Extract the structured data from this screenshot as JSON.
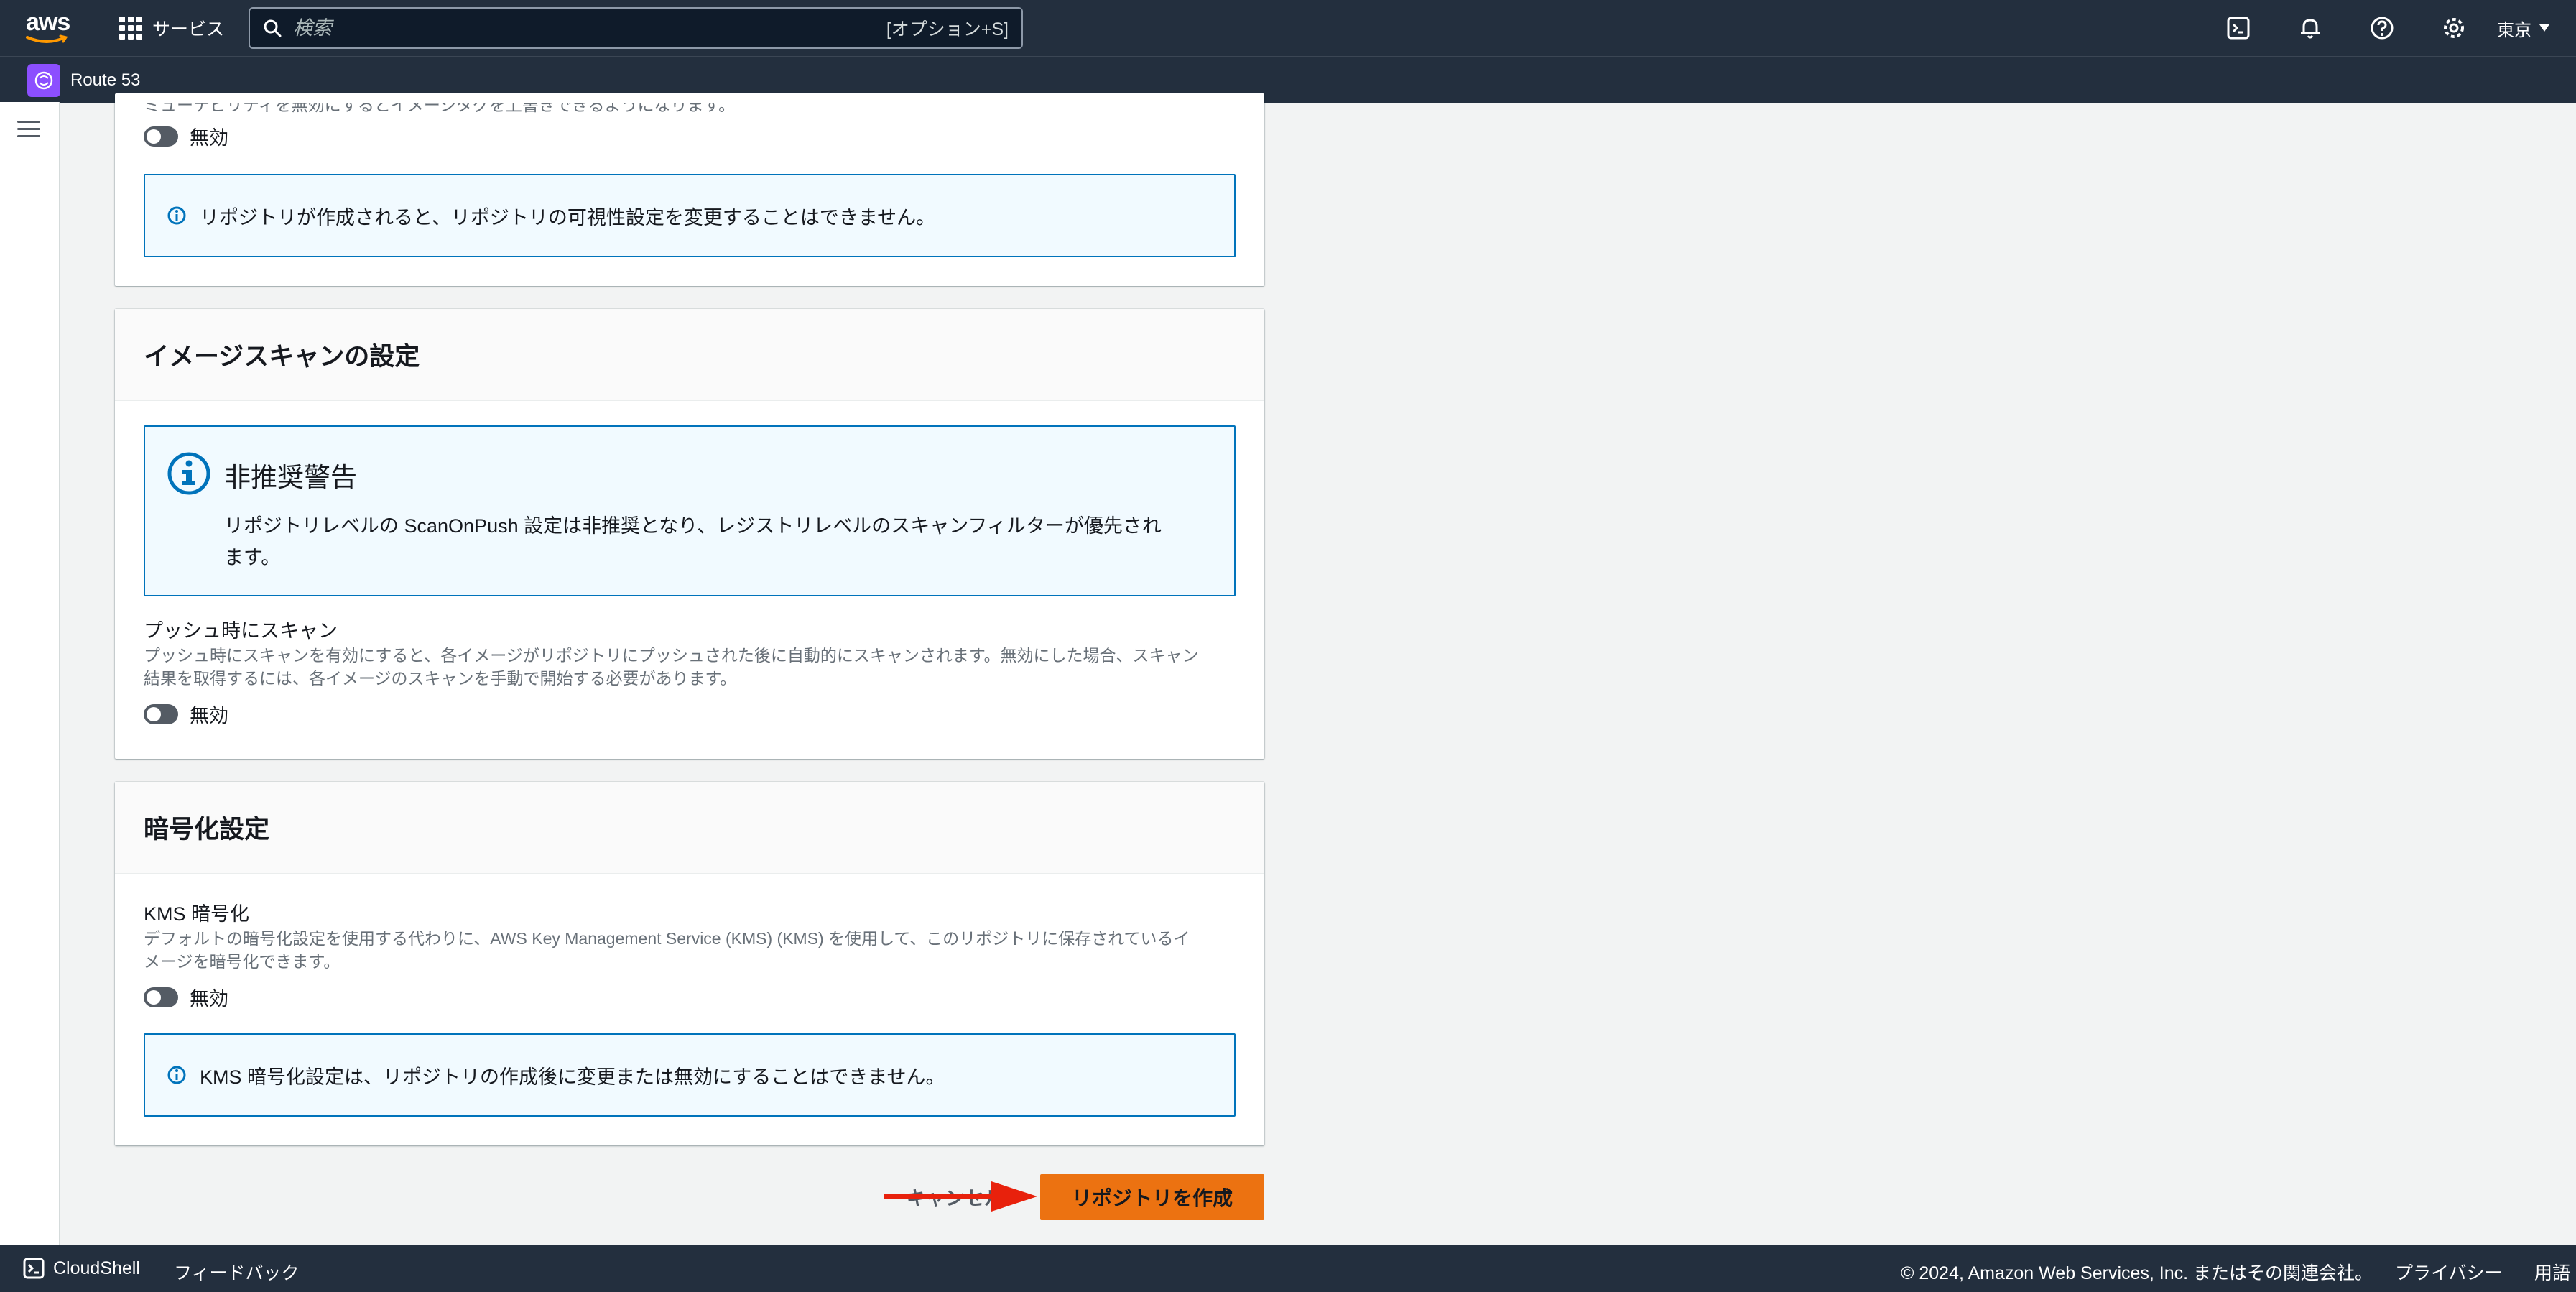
{
  "header": {
    "logo_text": "aws",
    "services_label": "サービス",
    "search_placeholder": "検索",
    "search_shortcut": "[オプション+S]",
    "region_label": "東京",
    "service_name": "Route 53"
  },
  "visibility_section": {
    "cut_off_desc": "ミューテビリティを無効にするとイメージタグを上書きできるようになります。",
    "toggle_label": "無効",
    "info_text": "リポジトリが作成されると、リポジトリの可視性設定を変更することはできません。"
  },
  "scan_section": {
    "title": "イメージスキャンの設定",
    "warning_title": "非推奨警告",
    "warning_text_line1": "リポジトリレベルの ScanOnPush 設定は非推奨となり、レジストリレベルのスキャンフィルターが優先され",
    "warning_text_line2": "ます。",
    "scan_on_push_label": "プッシュ時にスキャン",
    "scan_on_push_desc_line1": "プッシュ時にスキャンを有効にすると、各イメージがリポジトリにプッシュされた後に自動的にスキャンされます。無効にした場合、スキャン",
    "scan_on_push_desc_line2": "結果を取得するには、各イメージのスキャンを手動で開始する必要があります。",
    "toggle_label": "無効"
  },
  "encryption_section": {
    "title": "暗号化設定",
    "kms_label": "KMS 暗号化",
    "kms_desc_line1": "デフォルトの暗号化設定を使用する代わりに、AWS Key Management Service (KMS) (KMS) を使用して、このリポジトリに保存されているイ",
    "kms_desc_line2": "メージを暗号化できます。",
    "toggle_label": "無効",
    "info_text": "KMS 暗号化設定は、リポジトリの作成後に変更または無効にすることはできません。"
  },
  "actions": {
    "cancel_label": "キャンセル",
    "create_label": "リポジトリを作成"
  },
  "footer": {
    "cloudshell_label": "CloudShell",
    "feedback_label": "フィードバック",
    "copyright": "© 2024, Amazon Web Services, Inc. またはその関連会社。",
    "privacy_label": "プライバシー",
    "terms_label": "用語"
  },
  "colors": {
    "nav_bg": "#232f3e",
    "primary_button": "#ec7211",
    "info_border": "#0073bb",
    "info_bg": "#f1faff",
    "annotation_arrow": "#e8210c"
  }
}
